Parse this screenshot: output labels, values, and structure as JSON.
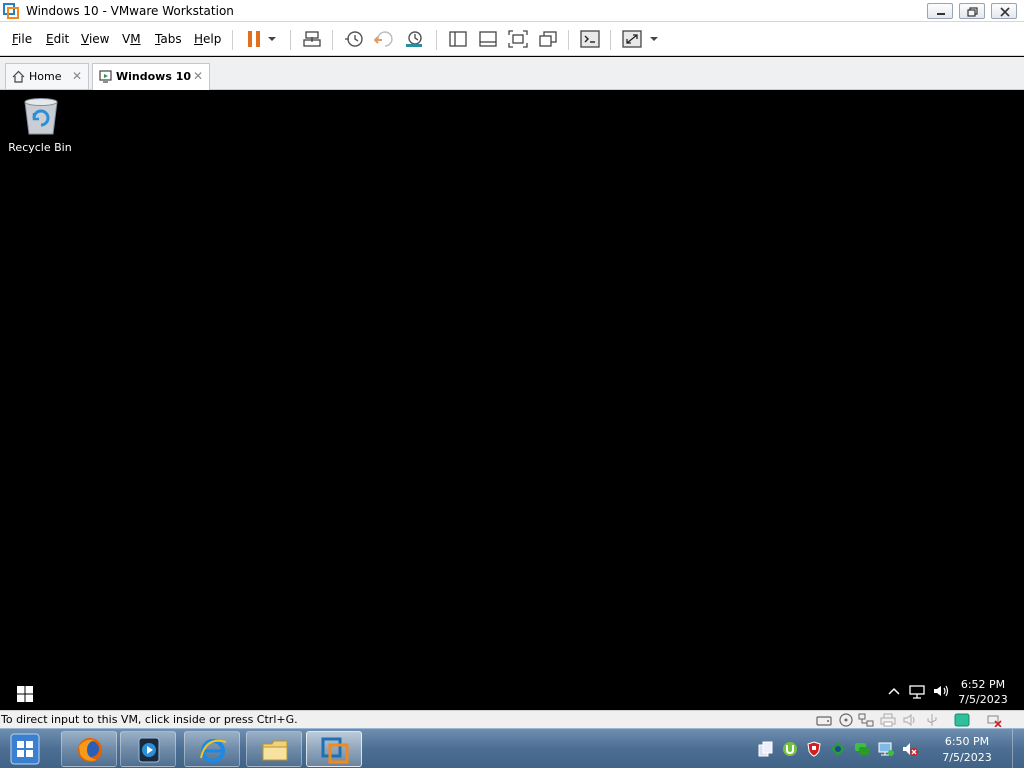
{
  "window": {
    "title": "Windows 10 - VMware Workstation"
  },
  "menu": {
    "items": [
      {
        "pre": "",
        "accel": "F",
        "post": "ile"
      },
      {
        "pre": "",
        "accel": "E",
        "post": "dit"
      },
      {
        "pre": "",
        "accel": "V",
        "post": "iew"
      },
      {
        "pre": "V",
        "accel": "M",
        "post": ""
      },
      {
        "pre": "",
        "accel": "T",
        "post": "abs"
      },
      {
        "pre": "",
        "accel": "H",
        "post": "elp"
      }
    ]
  },
  "tabs": [
    {
      "label": "Home",
      "close": "✕",
      "icon": "home-icon"
    },
    {
      "label": "Windows 10",
      "close": "✕",
      "icon": "vm-icon",
      "active": true
    }
  ],
  "guest": {
    "desktop_icons": [
      {
        "label": "Recycle Bin",
        "icon": "recycle-bin-icon"
      }
    ],
    "clock": {
      "time": "6:52 PM",
      "date": "7/5/2023"
    }
  },
  "statusbar": {
    "text": "To direct input to this VM, click inside or press Ctrl+G."
  },
  "host_taskbar": {
    "apps": [
      "firefox-icon",
      "media-player-icon",
      "internet-explorer-icon",
      "file-explorer-icon",
      "vmware-icon"
    ],
    "clock": {
      "time": "6:50 PM",
      "date": "7/5/2023"
    }
  },
  "colors": {
    "accent": "#e07020",
    "guest_desktop": "#000000",
    "host_taskbar": "#4d6f93"
  }
}
